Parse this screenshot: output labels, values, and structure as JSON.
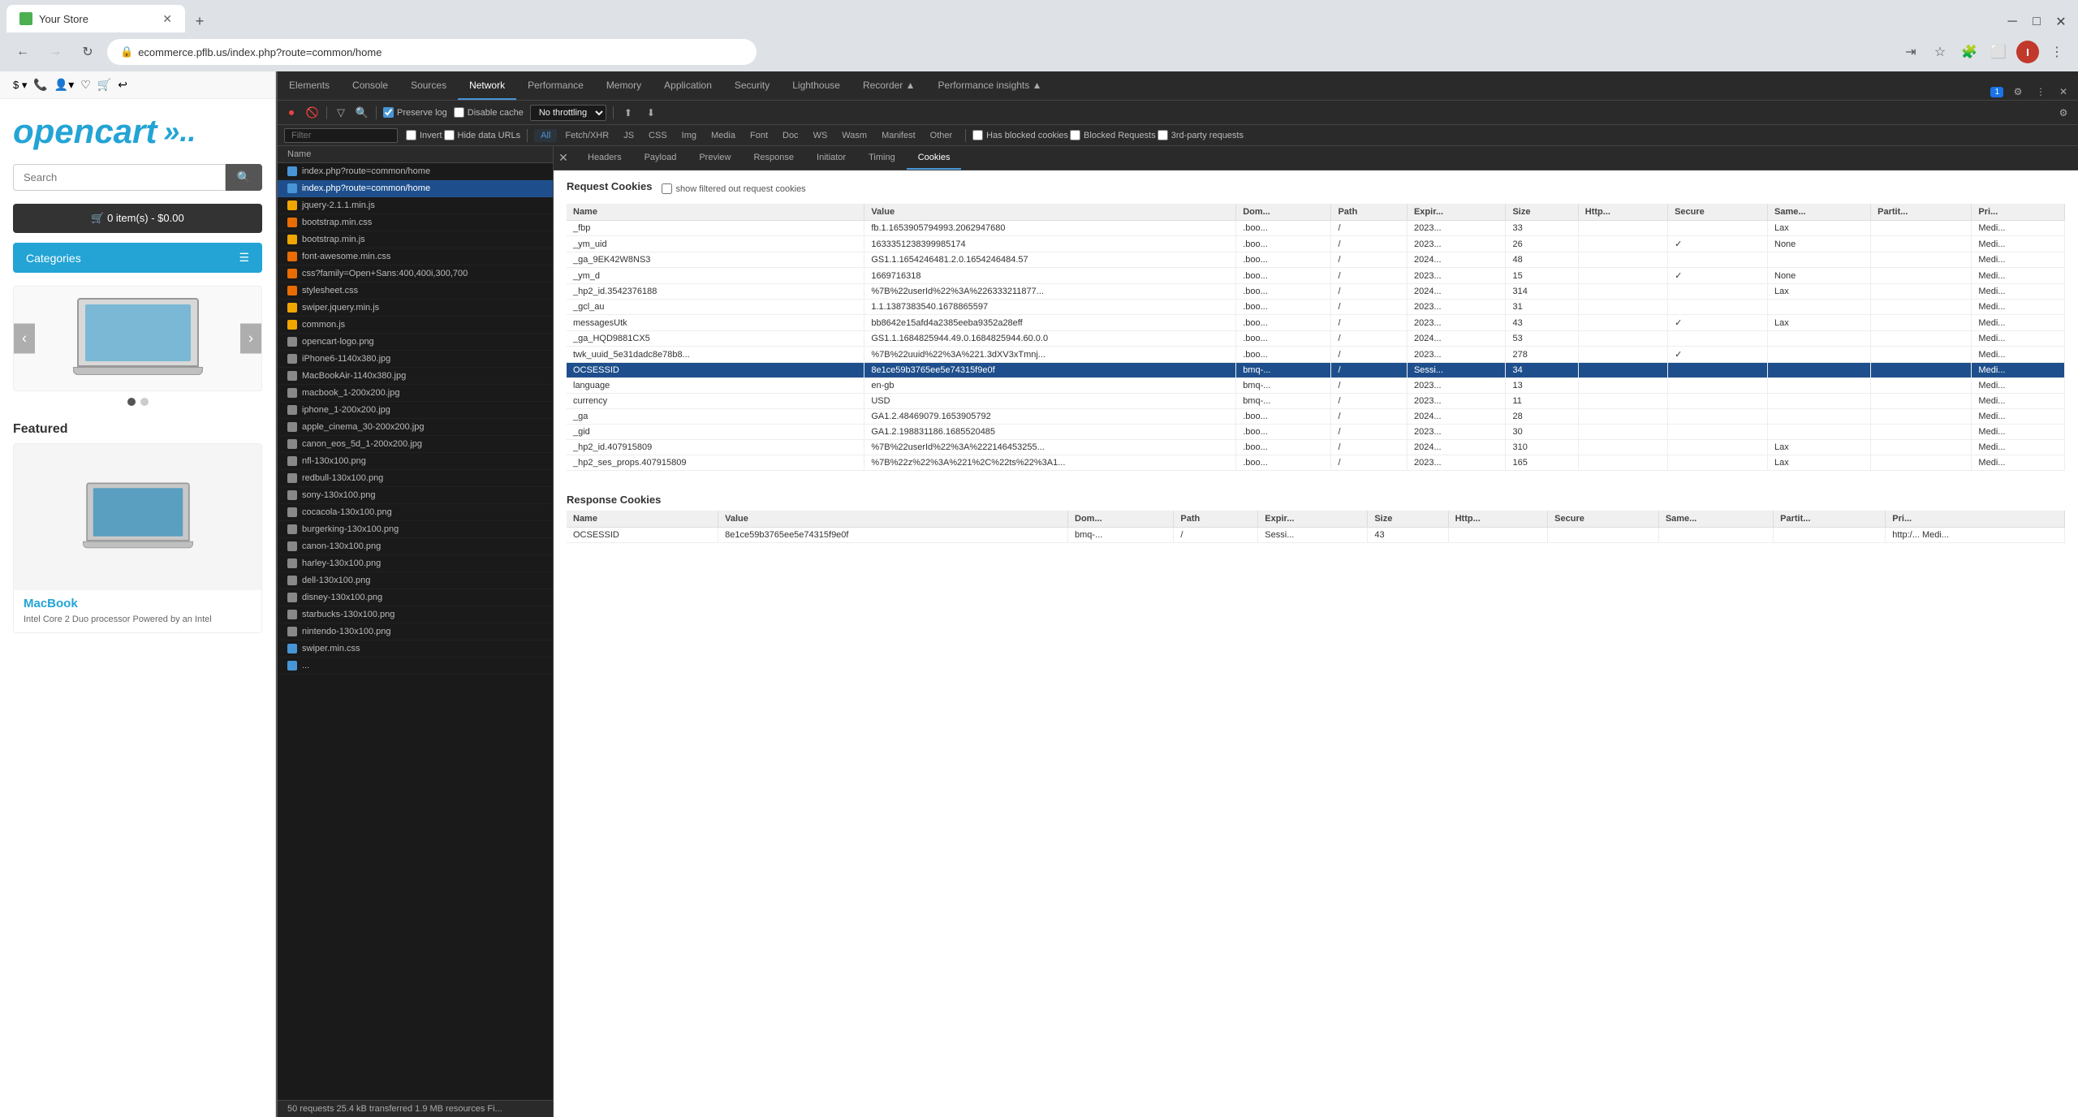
{
  "browser": {
    "tab_title": "Your Store",
    "url": "ecommerce.pflb.us/index.php?route=common/home",
    "new_tab_symbol": "+",
    "minimize": "─",
    "maximize": "□",
    "close": "✕"
  },
  "website": {
    "toolbar_items": [
      "$▾",
      "📞",
      "👤▾",
      "♡",
      "🛒",
      "↩"
    ],
    "logo_text": "opencart",
    "search_placeholder": "Search",
    "search_btn": "🔍",
    "cart_text": "🛒 0 item(s) - $0.00",
    "categories_text": "Categories",
    "featured_title": "Featured",
    "product_name": "MacBook",
    "product_desc": "Intel Core 2 Duo processor Powered by an Intel"
  },
  "devtools": {
    "panel_tabs": [
      "Elements",
      "Console",
      "Sources",
      "Network",
      "Performance",
      "Memory",
      "Application",
      "Security",
      "Lighthouse",
      "Recorder ▲",
      "Performance insights ▲"
    ],
    "active_tab": "Network",
    "close_icon": "✕",
    "settings_icon": "⚙",
    "more_icon": "⋮",
    "toolbar": {
      "record_icon": "⏺",
      "clear_icon": "🚫",
      "filter_icon": "▽",
      "search_icon": "🔍",
      "preserve_log_label": "Preserve log",
      "disable_cache_label": "Disable cache",
      "throttle_value": "No throttling",
      "import_icon": "⬆",
      "export_icon": "⬇"
    },
    "filter_chips": [
      "All",
      "Fetch/XHR",
      "JS",
      "CSS",
      "Img",
      "Media",
      "Font",
      "Doc",
      "WS",
      "Wasm",
      "Manifest",
      "Other"
    ],
    "active_filter": "All",
    "filter_checkboxes": [
      "Has blocked cookies",
      "Blocked Requests",
      "3rd-party requests"
    ],
    "filter_extra": [
      "Invert",
      "Hide data URLs"
    ],
    "detail_tabs": [
      "Headers",
      "Payload",
      "Preview",
      "Response",
      "Initiator",
      "Timing",
      "Cookies"
    ],
    "active_detail_tab": "Cookies",
    "network_list_header": "Name",
    "network_rows": [
      {
        "name": "index.php?route=common/home",
        "icon": "blue"
      },
      {
        "name": "index.php?route=common/home",
        "icon": "blue",
        "selected": true
      },
      {
        "name": "jquery-2.1.1.min.js",
        "icon": "yellow"
      },
      {
        "name": "bootstrap.min.css",
        "icon": "orange"
      },
      {
        "name": "bootstrap.min.js",
        "icon": "yellow"
      },
      {
        "name": "font-awesome.min.css",
        "icon": "orange"
      },
      {
        "name": "css?family=Open+Sans:400,400i,300,700",
        "icon": "orange"
      },
      {
        "name": "stylesheet.css",
        "icon": "orange"
      },
      {
        "name": "swiper.jquery.min.js",
        "icon": "yellow"
      },
      {
        "name": "common.js",
        "icon": "yellow"
      },
      {
        "name": "opencart-logo.png",
        "icon": "green"
      },
      {
        "name": "iPhone6-1140x380.jpg",
        "icon": "green"
      },
      {
        "name": "MacBookAir-1140x380.jpg",
        "icon": "green"
      },
      {
        "name": "macbook_1-200x200.jpg",
        "icon": "green"
      },
      {
        "name": "iphone_1-200x200.jpg",
        "icon": "green"
      },
      {
        "name": "apple_cinema_30-200x200.jpg",
        "icon": "green"
      },
      {
        "name": "canon_eos_5d_1-200x200.jpg",
        "icon": "green"
      },
      {
        "name": "nfl-130x100.png",
        "icon": "green"
      },
      {
        "name": "redbull-130x100.png",
        "icon": "green"
      },
      {
        "name": "sony-130x100.png",
        "icon": "green"
      },
      {
        "name": "cocacola-130x100.png",
        "icon": "green"
      },
      {
        "name": "burgerking-130x100.png",
        "icon": "green"
      },
      {
        "name": "canon-130x100.png",
        "icon": "green"
      },
      {
        "name": "harley-130x100.png",
        "icon": "green"
      },
      {
        "name": "dell-130x100.png",
        "icon": "green"
      },
      {
        "name": "disney-130x100.png",
        "icon": "green"
      },
      {
        "name": "starbucks-130x100.png",
        "icon": "green"
      },
      {
        "name": "nintendo-130x100.png",
        "icon": "green"
      },
      {
        "name": "swiper.min.css",
        "icon": "blue"
      },
      {
        "name": "...",
        "icon": "blue"
      }
    ],
    "status_bar": "50 requests   25.4 kB transferred   1.9 MB resources   Fi...",
    "request_cookies_title": "Request Cookies",
    "show_filtered_label": "show filtered out request cookies",
    "request_cookies_columns": [
      "Name",
      "Value",
      "Dom...",
      "Path",
      "Expir...",
      "Size",
      "Http...",
      "Secure",
      "Same...",
      "Partit...",
      "Pri..."
    ],
    "request_cookies": [
      {
        "name": "_fbp",
        "value": "fb.1.1653905794993.2062947680",
        "dom": ".boo...",
        "path": "/",
        "expir": "2023...",
        "size": "33",
        "http": "",
        "secure": "",
        "same": "Lax",
        "partit": "",
        "pri": "Medi..."
      },
      {
        "name": "_ym_uid",
        "value": "1633351238399985174",
        "dom": ".boo...",
        "path": "/",
        "expir": "2023...",
        "size": "26",
        "http": "",
        "secure": "✓",
        "same": "None",
        "partit": "",
        "pri": "Medi..."
      },
      {
        "name": "_ga_9EK42W8NS3",
        "value": "GS1.1.1654246481.2.0.1654246484.57",
        "dom": ".boo...",
        "path": "/",
        "expir": "2024...",
        "size": "48",
        "http": "",
        "secure": "",
        "same": "",
        "partit": "",
        "pri": "Medi..."
      },
      {
        "name": "_ym_d",
        "value": "1669716318",
        "dom": ".boo...",
        "path": "/",
        "expir": "2023...",
        "size": "15",
        "http": "",
        "secure": "✓",
        "same": "None",
        "partit": "",
        "pri": "Medi..."
      },
      {
        "name": "_hp2_id.3542376188",
        "value": "%7B%22userId%22%3A%226333211877...",
        "dom": ".boo...",
        "path": "/",
        "expir": "2024...",
        "size": "314",
        "http": "",
        "secure": "",
        "same": "Lax",
        "partit": "",
        "pri": "Medi..."
      },
      {
        "name": "_gcl_au",
        "value": "1.1.1387383540.1678865597",
        "dom": ".boo...",
        "path": "/",
        "expir": "2023...",
        "size": "31",
        "http": "",
        "secure": "",
        "same": "",
        "partit": "",
        "pri": "Medi..."
      },
      {
        "name": "messagesUtk",
        "value": "bb8642e15afd4a2385eeba9352a28eff",
        "dom": ".boo...",
        "path": "/",
        "expir": "2023...",
        "size": "43",
        "http": "",
        "secure": "✓",
        "same": "Lax",
        "partit": "",
        "pri": "Medi..."
      },
      {
        "name": "_ga_HQD9881CX5",
        "value": "GS1.1.1684825944.49.0.1684825944.60.0.0",
        "dom": ".boo...",
        "path": "/",
        "expir": "2024...",
        "size": "53",
        "http": "",
        "secure": "",
        "same": "",
        "partit": "",
        "pri": "Medi..."
      },
      {
        "name": "twk_uuid_5e31dadc8e78b8...",
        "value": "%7B%22uuid%22%3A%221.3dXV3xTmnj...",
        "dom": ".boo...",
        "path": "/",
        "expir": "2023...",
        "size": "278",
        "http": "",
        "secure": "✓",
        "same": "",
        "partit": "",
        "pri": "Medi..."
      },
      {
        "name": "OCSESSID",
        "value": "8e1ce59b3765ee5e74315f9e0f",
        "dom": "bmq-...",
        "path": "/",
        "expir": "Sessi...",
        "size": "34",
        "http": "",
        "secure": "",
        "same": "",
        "partit": "",
        "pri": "Medi...",
        "highlighted": true
      },
      {
        "name": "language",
        "value": "en-gb",
        "dom": "bmq-...",
        "path": "/",
        "expir": "2023...",
        "size": "13",
        "http": "",
        "secure": "",
        "same": "",
        "partit": "",
        "pri": "Medi..."
      },
      {
        "name": "currency",
        "value": "USD",
        "dom": "bmq-...",
        "path": "/",
        "expir": "2023...",
        "size": "11",
        "http": "",
        "secure": "",
        "same": "",
        "partit": "",
        "pri": "Medi..."
      },
      {
        "name": "_ga",
        "value": "GA1.2.48469079.1653905792",
        "dom": ".boo...",
        "path": "/",
        "expir": "2024...",
        "size": "28",
        "http": "",
        "secure": "",
        "same": "",
        "partit": "",
        "pri": "Medi..."
      },
      {
        "name": "_gid",
        "value": "GA1.2.198831186.1685520485",
        "dom": ".boo...",
        "path": "/",
        "expir": "2023...",
        "size": "30",
        "http": "",
        "secure": "",
        "same": "",
        "partit": "",
        "pri": "Medi..."
      },
      {
        "name": "_hp2_id.407915809",
        "value": "%7B%22userId%22%3A%222146453255...",
        "dom": ".boo...",
        "path": "/",
        "expir": "2024...",
        "size": "310",
        "http": "",
        "secure": "",
        "same": "Lax",
        "partit": "",
        "pri": "Medi..."
      },
      {
        "name": "_hp2_ses_props.407915809",
        "value": "%7B%22z%22%3A%221%2C%22ts%22%3A1...",
        "dom": ".boo...",
        "path": "/",
        "expir": "2023...",
        "size": "165",
        "http": "",
        "secure": "",
        "same": "Lax",
        "partit": "",
        "pri": "Medi..."
      }
    ],
    "response_cookies_title": "Response Cookies",
    "response_cookies_columns": [
      "Name",
      "Value",
      "Dom...",
      "Path",
      "Expir...",
      "Size",
      "Http...",
      "Secure",
      "Same...",
      "Partit...",
      "Pri..."
    ],
    "response_cookies": [
      {
        "name": "OCSESSID",
        "value": "8e1ce59b3765ee5e74315f9e0f",
        "dom": "bmq-...",
        "path": "/",
        "expir": "Sessi...",
        "size": "43",
        "http": "",
        "secure": "",
        "same": "",
        "partit": "",
        "pri": "http:/...   Medi..."
      }
    ]
  }
}
